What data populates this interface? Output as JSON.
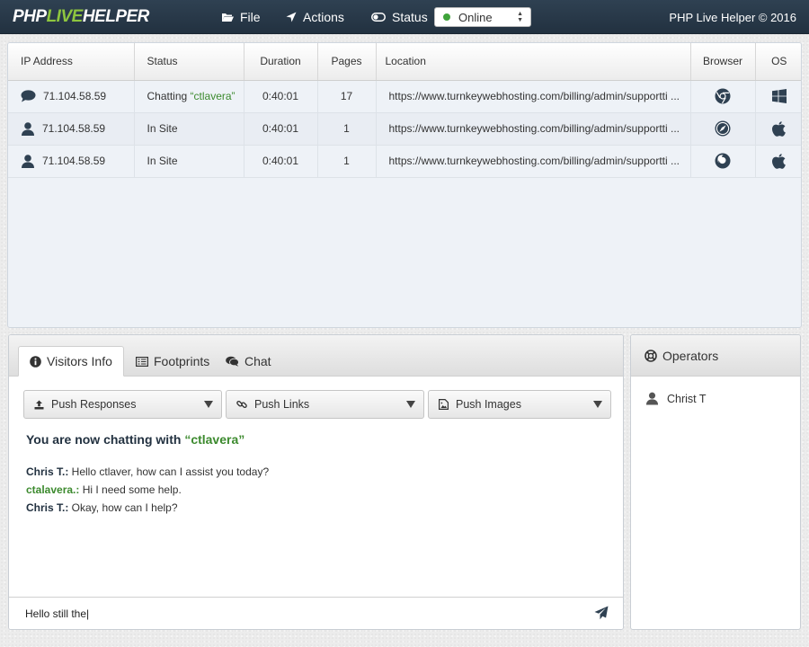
{
  "header": {
    "logo_part1": "PHP",
    "logo_part2": "LIVE",
    "logo_part3": "HELPER",
    "menu": [
      {
        "label": "File",
        "icon": "folder-icon"
      },
      {
        "label": "Actions",
        "icon": "location-arrow-icon"
      },
      {
        "label": "Status",
        "icon": "toggle-icon"
      }
    ],
    "status_value": "Online",
    "status_color": "#3fa33a",
    "copyright": "PHP Live Helper © 2016"
  },
  "visitors": {
    "columns": {
      "ip": "IP Address",
      "status": "Status",
      "duration": "Duration",
      "pages": "Pages",
      "location": "Location",
      "browser": "Browser",
      "os": "OS"
    },
    "rows": [
      {
        "icon": "chat-bubble-icon",
        "ip": "71.104.58.59",
        "status_prefix": "Chatting ",
        "status_highlight": "“ctlavera”",
        "duration": "0:40:01",
        "pages": "17",
        "location": "https://www.turnkeywebhosting.com/billing/admin/supportti ...",
        "browser": "chrome-icon",
        "os": "windows-icon"
      },
      {
        "icon": "user-icon",
        "ip": "71.104.58.59",
        "status_prefix": "In Site",
        "status_highlight": "",
        "duration": "0:40:01",
        "pages": "1",
        "location": "https://www.turnkeywebhosting.com/billing/admin/supportti ...",
        "browser": "safari-icon",
        "os": "apple-icon"
      },
      {
        "icon": "user-icon",
        "ip": "71.104.58.59",
        "status_prefix": "In Site",
        "status_highlight": "",
        "duration": "0:40:01",
        "pages": "1",
        "location": "https://www.turnkeywebhosting.com/billing/admin/supportti ...",
        "browser": "firefox-icon",
        "os": "apple-icon"
      }
    ]
  },
  "chat": {
    "tabs": [
      {
        "label": "Visitors Info",
        "icon": "info-circle-icon",
        "active": true
      },
      {
        "label": "Footprints",
        "icon": "list-icon",
        "active": false
      },
      {
        "label": "Chat",
        "icon": "comments-icon",
        "active": false
      }
    ],
    "push_buttons": [
      {
        "label": "Push Responses",
        "icon": "upload-icon"
      },
      {
        "label": "Push Links",
        "icon": "link-icon"
      },
      {
        "label": "Push Images",
        "icon": "image-file-icon"
      }
    ],
    "heading_prefix": "You are now chatting with ",
    "heading_name": "“ctlavera”",
    "messages": [
      {
        "who": "Chris T.:",
        "text": " Hello ctlaver, how can I assist you today?",
        "role": "operator"
      },
      {
        "who": "ctalavera.:",
        "text": " Hi I need some help.",
        "role": "visitor"
      },
      {
        "who": "Chris T.:",
        "text": " Okay, how can I help?",
        "role": "operator"
      }
    ],
    "input_value": "Hello still the|"
  },
  "operators": {
    "title": "Operators",
    "list": [
      {
        "name": "Christ T"
      }
    ]
  },
  "colors": {
    "header_bg": "#2a3a4a",
    "accent_green": "#8ec63f",
    "text_green": "#3c8a2e",
    "dark_navy": "#223140"
  }
}
